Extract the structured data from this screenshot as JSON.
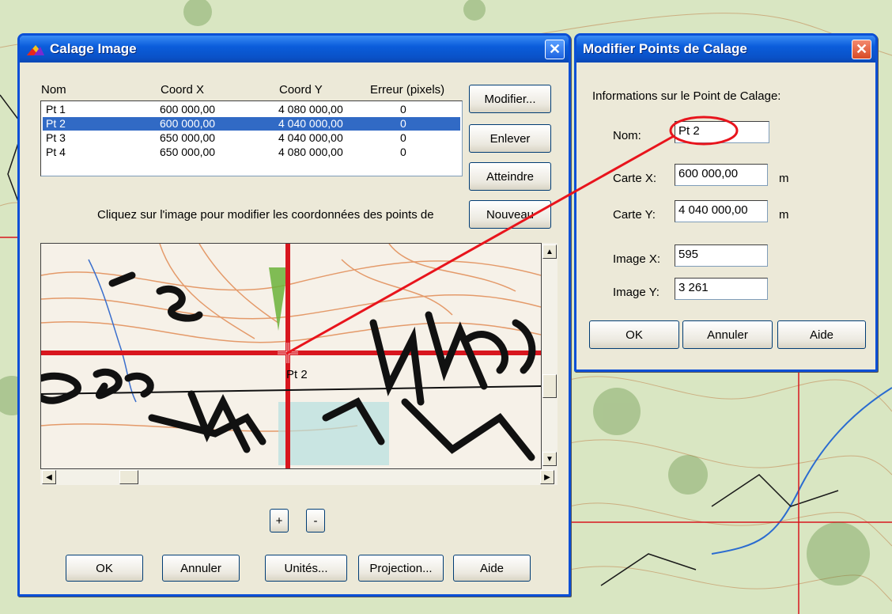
{
  "calage": {
    "title": "Calage Image",
    "columns": [
      "Nom",
      "Coord X",
      "Coord Y",
      "Erreur (pixels)"
    ],
    "rows": [
      {
        "nom": "Pt 1",
        "x": "600 000,00",
        "y": "4 080 000,00",
        "err": "0"
      },
      {
        "nom": "Pt 2",
        "x": "600 000,00",
        "y": "4 040 000,00",
        "err": "0"
      },
      {
        "nom": "Pt 3",
        "x": "650 000,00",
        "y": "4 040 000,00",
        "err": "0"
      },
      {
        "nom": "Pt 4",
        "x": "650 000,00",
        "y": "4 080 000,00",
        "err": "0"
      }
    ],
    "selected_row": 1,
    "buttons": {
      "modifier": "Modifier...",
      "enlever": "Enlever",
      "atteindre": "Atteindre",
      "nouveau": "Nouveau"
    },
    "instruction": "Cliquez sur l'image pour modifier les coordonnées des points de",
    "marker_label": "Pt 2",
    "zoom_in": "+",
    "zoom_out": "-",
    "bottom_buttons": {
      "ok": "OK",
      "annuler": "Annuler",
      "unites": "Unités...",
      "projection": "Projection...",
      "aide": "Aide"
    }
  },
  "modifier": {
    "title": "Modifier Points de Calage",
    "group_label": "Informations sur le Point de Calage:",
    "nom_label": "Nom:",
    "nom_value": "Pt 2",
    "carte_x_label": "Carte X:",
    "carte_x_value": "600 000,00",
    "carte_x_unit": "m",
    "carte_y_label": "Carte Y:",
    "carte_y_value": "4 040 000,00",
    "carte_y_unit": "m",
    "image_x_label": "Image X:",
    "image_x_value": "595",
    "image_y_label": "Image Y:",
    "image_y_value": "3 261",
    "buttons": {
      "ok": "OK",
      "annuler": "Annuler",
      "aide": "Aide"
    }
  },
  "colors": {
    "title_blue": "#0a52c8",
    "selection": "#316ac5",
    "annotation_red": "#e8141c",
    "map_red_line": "#d8161e"
  },
  "icons": [
    "app-icon",
    "close-icon",
    "scroll-up-icon",
    "scroll-down-icon",
    "scroll-left-icon",
    "scroll-right-icon",
    "crosshair-icon"
  ]
}
